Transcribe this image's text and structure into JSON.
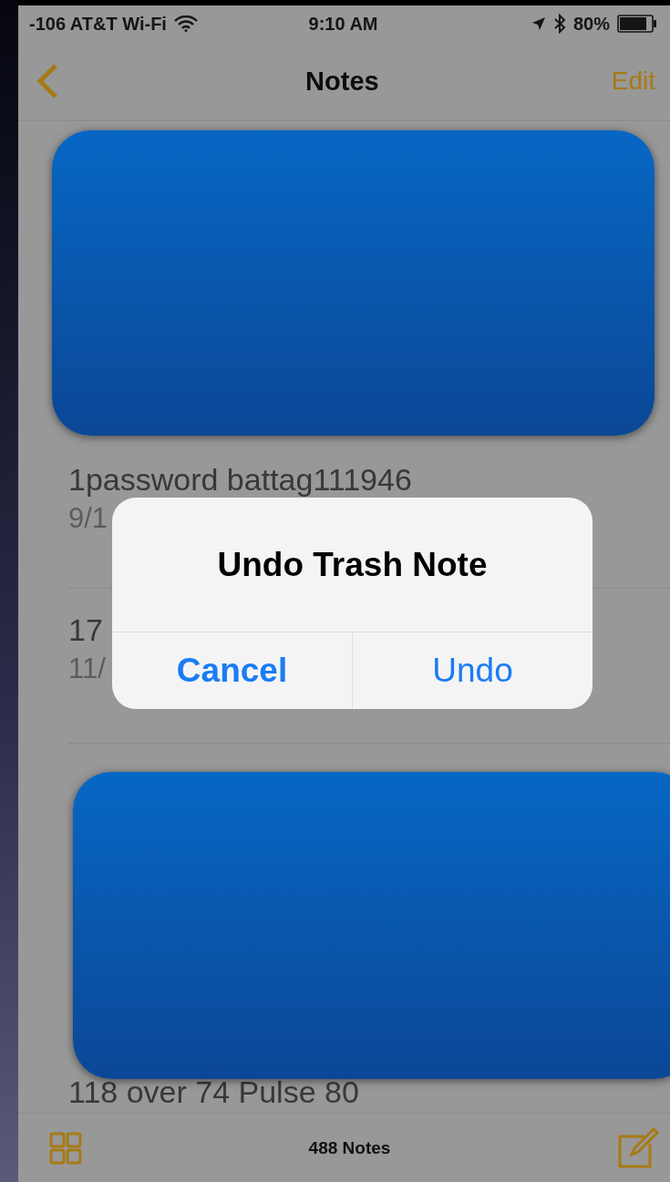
{
  "status_bar": {
    "carrier": "-106 AT&T Wi-Fi",
    "time": "9:10 AM",
    "battery": "80%"
  },
  "nav": {
    "title": "Notes",
    "edit": "Edit"
  },
  "notes": [
    {
      "kind": "note",
      "title": "1password battag111946",
      "date": "9/1"
    },
    {
      "kind": "note",
      "title": "17",
      "date": "11/"
    },
    {
      "kind": "cut",
      "title": "118 over 74  Pulse  80"
    }
  ],
  "alert": {
    "title": "Undo Trash Note",
    "buttons": [
      {
        "label": "Cancel",
        "kind": "cancel"
      },
      {
        "label": "Undo",
        "kind": "default"
      }
    ]
  },
  "toolbar": {
    "count": "488 Notes"
  }
}
